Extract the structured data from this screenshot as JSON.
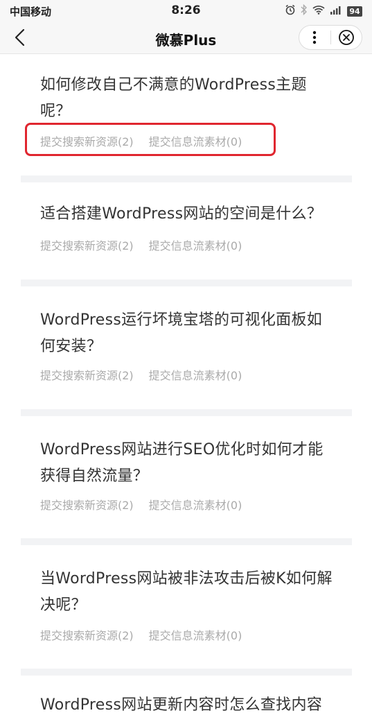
{
  "status_bar": {
    "carrier": "中国移动",
    "time": "8:26",
    "battery": "94",
    "icons": [
      "alarm-icon",
      "bluetooth-icon",
      "wifi-icon",
      "signal-icon",
      "battery-icon"
    ]
  },
  "nav": {
    "title": "微慕Plus",
    "back_icon": "chevron-left-icon",
    "more_icon": "more-vertical-icon",
    "close_icon": "close-circle-icon"
  },
  "questions": [
    {
      "title": "如何修改自己不满意的WordPress主题呢？",
      "search_label": "提交搜索新资源(2)",
      "feed_label": "提交信息流素材(0)"
    },
    {
      "title": "适合搭建WordPress网站的空间是什么？",
      "search_label": "提交搜索新资源(2)",
      "feed_label": "提交信息流素材(0)"
    },
    {
      "title": "WordPress运行坏境宝塔的可视化面板如何安装？",
      "search_label": "提交搜索新资源(2)",
      "feed_label": "提交信息流素材(0)"
    },
    {
      "title": "WordPress网站进行SEO优化时如何才能获得自然流量？",
      "search_label": "提交搜索新资源(2)",
      "feed_label": "提交信息流素材(0)"
    },
    {
      "title": "当WordPress网站被非法攻击后被K如何解决呢？",
      "search_label": "提交搜索新资源(2)",
      "feed_label": "提交信息流素材(0)"
    },
    {
      "title": "WordPress网站更新内容时怎么查找内容",
      "search_label": "",
      "feed_label": ""
    }
  ],
  "colors": {
    "highlight": "#e0262f",
    "meta_text": "#aaaaaa",
    "divider": "#f2f3f5"
  }
}
